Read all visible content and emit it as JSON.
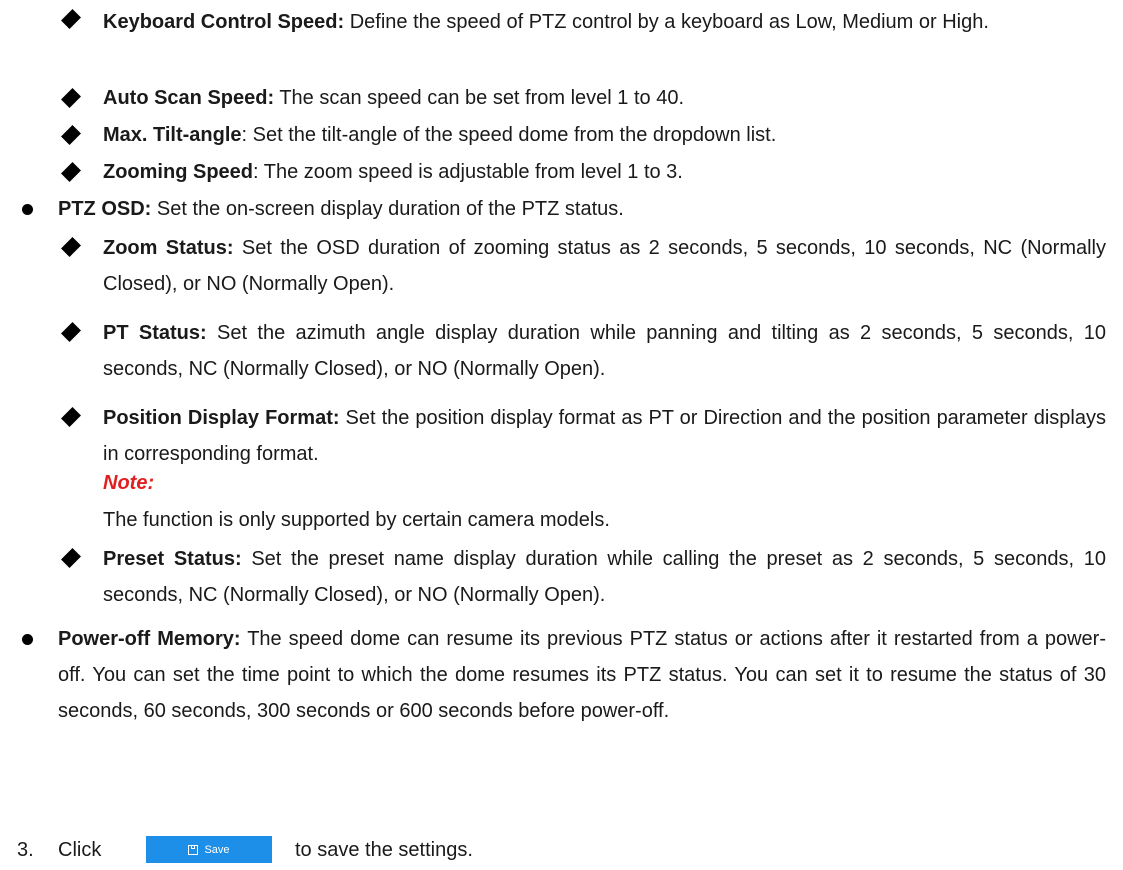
{
  "items": {
    "keyboard_speed": {
      "label": "Keyboard Control Speed:",
      "text": " Define the speed of PTZ control by a keyboard as Low, Medium or High."
    },
    "auto_scan_speed": {
      "label": "Auto Scan Speed:",
      "text": " The scan speed can be set from level 1 to 40."
    },
    "max_tilt": {
      "label": "Max. Tilt-angle",
      "text": ": Set the tilt-angle of the speed dome from the dropdown list."
    },
    "zooming_speed": {
      "label": "Zooming Speed",
      "text": ": The zoom speed is adjustable from level 1 to 3."
    },
    "ptz_osd": {
      "label": "PTZ OSD:",
      "text": " Set the on-screen display duration of the PTZ status."
    },
    "zoom_status": {
      "label": "Zoom Status:",
      "text": " Set the OSD duration of zooming status as 2 seconds, 5 seconds, 10 seconds, NC (Normally Closed), or NO (Normally Open)."
    },
    "pt_status": {
      "label": "PT Status:",
      "text": " Set the azimuth angle display duration while panning and tilting as 2 seconds, 5 seconds, 10 seconds, NC (Normally Closed), or NO (Normally Open)."
    },
    "position_format": {
      "label": "Position Display Format:",
      "text": " Set the position display format as PT or Direction and the position parameter displays in corresponding format."
    },
    "note": {
      "label": "Note:",
      "text": "The function is only supported by certain camera models."
    },
    "preset_status": {
      "label": "Preset Status:",
      "text": " Set the preset name display duration while calling the preset as 2 seconds, 5 seconds, 10 seconds, NC (Normally Closed), or NO (Normally Open)."
    },
    "power_off": {
      "label": "Power-off Memory:",
      "text": " The speed dome can resume its previous PTZ status or actions after it restarted from a power-off. You can set the time point to which the dome resumes its PTZ status. You can set it to resume the status of 30 seconds, 60 seconds, 300 seconds or 600 seconds before power-off."
    }
  },
  "step3": {
    "number": "3.",
    "click": "Click",
    "button_label": "Save",
    "after": "to save the settings."
  }
}
